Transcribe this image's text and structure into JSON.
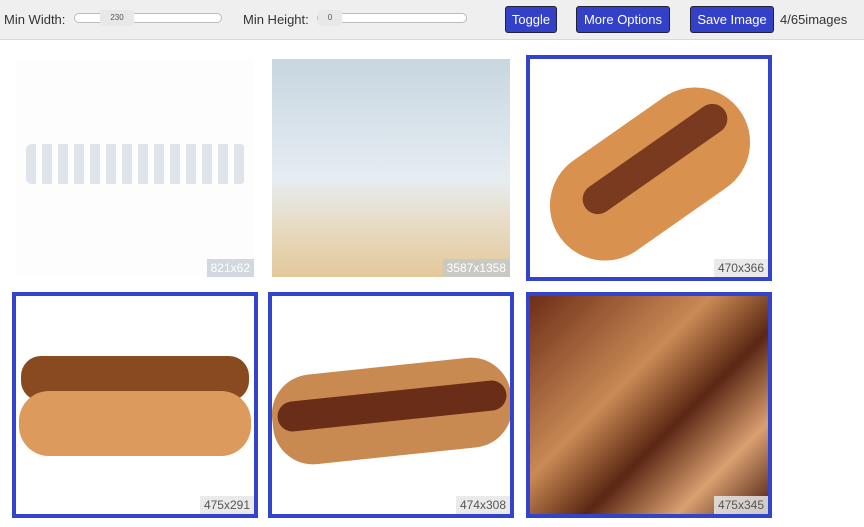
{
  "toolbar": {
    "min_width_label": "Min Width:",
    "min_width_value": "230",
    "min_height_label": "Min Height:",
    "min_height_value": "0",
    "toggle": "Toggle",
    "more_options": "More Options",
    "save_image": "Save Image",
    "count": "4/65images"
  },
  "colors": {
    "accent": "#3344cc"
  },
  "images": [
    {
      "size": "821x62",
      "selected": false
    },
    {
      "size": "3587x1358",
      "selected": false
    },
    {
      "size": "470x366",
      "selected": true
    },
    {
      "size": "475x291",
      "selected": true
    },
    {
      "size": "474x308",
      "selected": true
    },
    {
      "size": "475x345",
      "selected": true
    }
  ]
}
